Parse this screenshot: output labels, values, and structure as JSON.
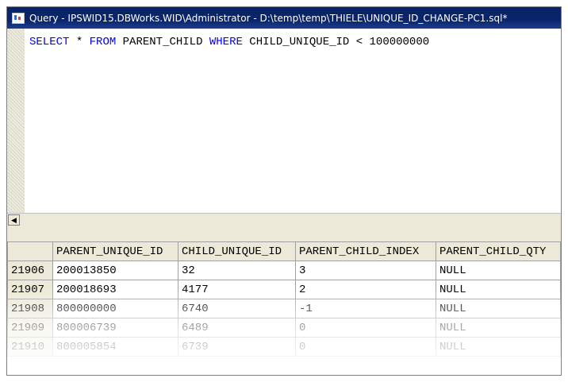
{
  "window": {
    "title": "Query - IPSWID15.DBWorks.WID\\Administrator - D:\\temp\\temp\\THIELE\\UNIQUE_ID_CHANGE-PC1.sql*"
  },
  "editor": {
    "tokens": [
      "SELECT",
      " * ",
      "FROM",
      " PARENT_CHILD ",
      "WHERE",
      " CHILD_UNIQUE_ID < 100000000"
    ]
  },
  "results": {
    "columns": [
      "PARENT_UNIQUE_ID",
      "CHILD_UNIQUE_ID",
      "PARENT_CHILD_INDEX",
      "PARENT_CHILD_QTY"
    ],
    "rows": [
      {
        "num": "21906",
        "cells": [
          "200013850",
          "32",
          "3",
          "NULL"
        ]
      },
      {
        "num": "21907",
        "cells": [
          "200018693",
          "4177",
          "2",
          "NULL"
        ]
      },
      {
        "num": "21908",
        "cells": [
          "800000000",
          "6740",
          "-1",
          "NULL"
        ]
      },
      {
        "num": "21909",
        "cells": [
          "800006739",
          "6489",
          "0",
          "NULL"
        ]
      },
      {
        "num": "21910",
        "cells": [
          "800005854",
          "6739",
          "0",
          "NULL"
        ]
      }
    ]
  },
  "colors": {
    "title_bar": "#0a246a",
    "keyword": "#0000ff",
    "chrome": "#ece9d8"
  }
}
